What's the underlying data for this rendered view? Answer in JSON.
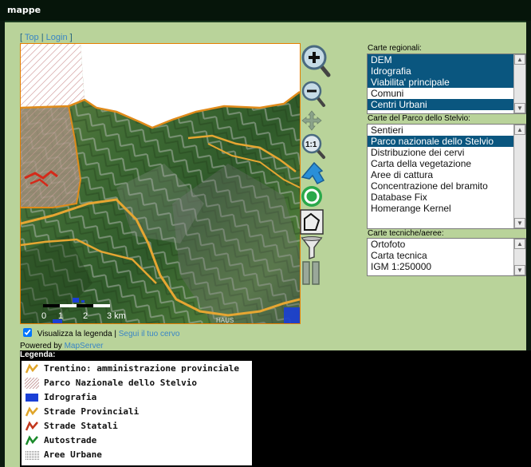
{
  "window": {
    "title": "mappe"
  },
  "toplinks": {
    "open": "[",
    "top": "Top",
    "sep": "|",
    "login": "Login",
    "close": "]"
  },
  "map": {
    "scale_labels": [
      "0",
      "1",
      "2",
      "3 km"
    ],
    "watermark": "HAUS"
  },
  "tools": [
    {
      "name": "zoom-in-icon"
    },
    {
      "name": "zoom-out-icon"
    },
    {
      "name": "pan-icon"
    },
    {
      "name": "zoom-1-1-icon"
    },
    {
      "name": "arrow-icon"
    },
    {
      "name": "refresh-icon"
    },
    {
      "name": "polygon-select-icon"
    },
    {
      "name": "filter-icon"
    },
    {
      "name": "pause-icon"
    }
  ],
  "carte_regionali": {
    "label": "Carte regionali:",
    "items": [
      {
        "label": "DEM",
        "selected": true
      },
      {
        "label": "Idrografia",
        "selected": true
      },
      {
        "label": "Viabilita' principale",
        "selected": true
      },
      {
        "label": "Comuni",
        "selected": false
      },
      {
        "label": "Centri Urbani",
        "selected": true
      }
    ]
  },
  "carte_parco": {
    "label": "Carte del Parco dello Stelvio:",
    "items": [
      {
        "label": "Sentieri",
        "selected": false
      },
      {
        "label": "Parco nazionale dello Stelvio",
        "selected": true
      },
      {
        "label": "Distribuzione dei cervi",
        "selected": false
      },
      {
        "label": "Carta della vegetazione",
        "selected": false
      },
      {
        "label": "Aree di cattura",
        "selected": false
      },
      {
        "label": "Concentrazione del bramito",
        "selected": false
      },
      {
        "label": "Database Fix",
        "selected": false
      },
      {
        "label": "Homerange Kernel",
        "selected": false
      }
    ]
  },
  "carte_tecniche": {
    "label": "Carte tecniche/aeree:",
    "items": [
      {
        "label": "Ortofoto",
        "selected": false
      },
      {
        "label": "Carta tecnica",
        "selected": false
      },
      {
        "label": "IGM 1:250000",
        "selected": false
      }
    ]
  },
  "options": {
    "show_legend_label": "Visualizza la legenda",
    "show_legend_checked": true,
    "sep": "|",
    "follow_deer_label": "Segui il tuo cervo",
    "powered_by": "Powered by",
    "mapserver": "MapServer"
  },
  "legend": {
    "title": "Legenda:",
    "items": [
      {
        "label": "Trentino: amministrazione provinciale",
        "symbol": "line",
        "color": "#e0a52a"
      },
      {
        "label": "Parco Nazionale dello Stelvio",
        "symbol": "hatch",
        "color": "#c8a0a0"
      },
      {
        "label": "Idrografia",
        "symbol": "fill",
        "color": "#1a3fd6"
      },
      {
        "label": "Strade Provinciali",
        "symbol": "line",
        "color": "#e0a52a"
      },
      {
        "label": "Strade Statali",
        "symbol": "line",
        "color": "#c2361c"
      },
      {
        "label": "Autostrade",
        "symbol": "line",
        "color": "#1a8a2a"
      },
      {
        "label": "Aree Urbane",
        "symbol": "dots",
        "color": "#777777"
      }
    ]
  }
}
